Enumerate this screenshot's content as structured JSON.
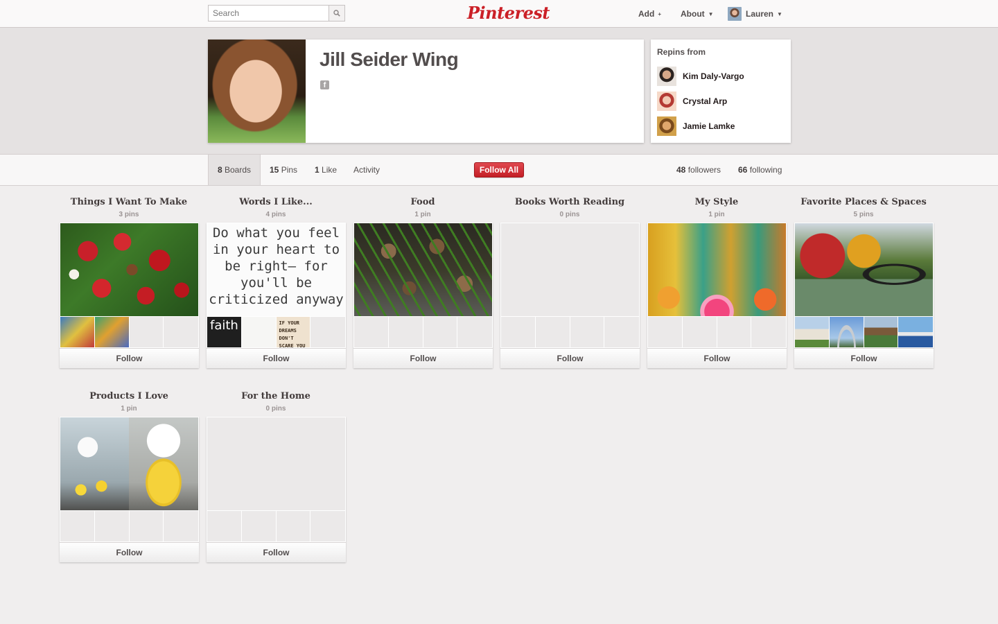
{
  "header": {
    "search_placeholder": "Search",
    "logo_text": "Pinterest",
    "nav_add": "Add",
    "nav_about": "About",
    "nav_user": "Lauren",
    "accent_color": "#cb2027"
  },
  "profile": {
    "name": "Jill Seider Wing",
    "repins_title": "Repins from",
    "repins": [
      {
        "name": "Kim Daly-Vargo"
      },
      {
        "name": "Crystal Arp"
      },
      {
        "name": "Jamie Lamke"
      }
    ]
  },
  "stats": {
    "boards_count": "8",
    "boards_label": "Boards",
    "pins_count": "15",
    "pins_label": "Pins",
    "likes_count": "1",
    "likes_label": "Like",
    "activity_label": "Activity",
    "follow_all_label": "Follow All",
    "followers_count": "48",
    "followers_label": "followers",
    "following_count": "66",
    "following_label": "following"
  },
  "boards": [
    {
      "title": "Things I Want To Make",
      "count": "3 pins",
      "follow": "Follow"
    },
    {
      "title": "Words I Like...",
      "count": "4 pins",
      "follow": "Follow",
      "quote": "Do what you feel in your heart to be right— for you'll be criticized anyway",
      "thumb_1": "faith",
      "thumb_3": "IF YOUR DREAMS DON'T SCARE YOU"
    },
    {
      "title": "Food",
      "count": "1 pin",
      "follow": "Follow"
    },
    {
      "title": "Books Worth Reading",
      "count": "0 pins",
      "follow": "Follow"
    },
    {
      "title": "My Style",
      "count": "1 pin",
      "follow": "Follow"
    },
    {
      "title": "Favorite Places & Spaces",
      "count": "5 pins",
      "follow": "Follow"
    },
    {
      "title": "Products I Love",
      "count": "1 pin",
      "follow": "Follow"
    },
    {
      "title": "For the Home",
      "count": "0 pins",
      "follow": "Follow"
    }
  ]
}
